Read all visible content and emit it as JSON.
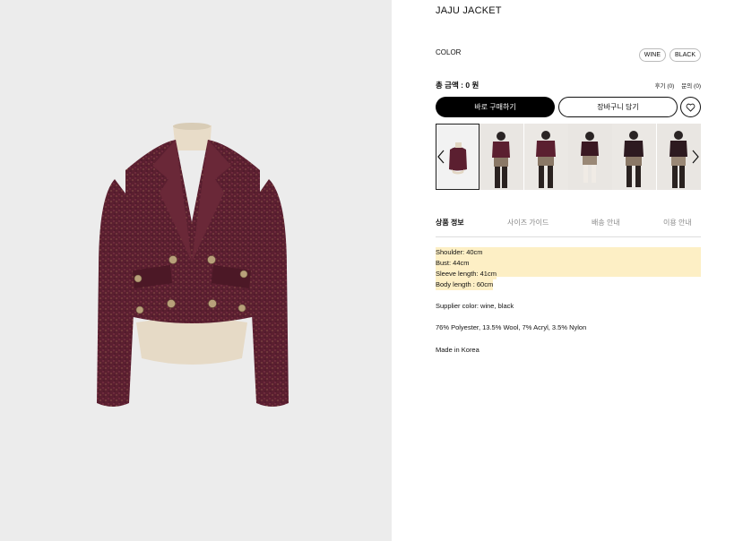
{
  "product": {
    "title": "JAJU JACKET",
    "color_label": "COLOR",
    "colors": [
      "WINE",
      "BLACK"
    ],
    "total_label": "총 금액 : 0 원",
    "reviews_link": "후기 (0)",
    "qna_link": "문의 (0)",
    "buy_now_label": "바로 구매하기",
    "add_to_cart_label": "장바구니 담기"
  },
  "tabs": [
    "상품 정보",
    "사이즈 가이드",
    "배송 안내",
    "이용 안내"
  ],
  "details": {
    "measurements": [
      "Shoulder: 40cm",
      "Bust: 44cm",
      "Sleeve length: 41cm",
      "Body length : 60cm"
    ],
    "supplier_color": "Supplier color: wine, black",
    "composition": "76% Polyester, 13.5% Wool, 7% Acryl, 3.5% Nylon",
    "origin": "Made in Korea"
  },
  "colors": {
    "accent": "#000000",
    "highlight": "#fdefc5",
    "hero_bg": "#ececec",
    "jacket": "#5a1f2e"
  },
  "icons": {
    "like": "heart-outline-icon",
    "prev": "chevron-left-icon",
    "next": "chevron-right-icon"
  }
}
